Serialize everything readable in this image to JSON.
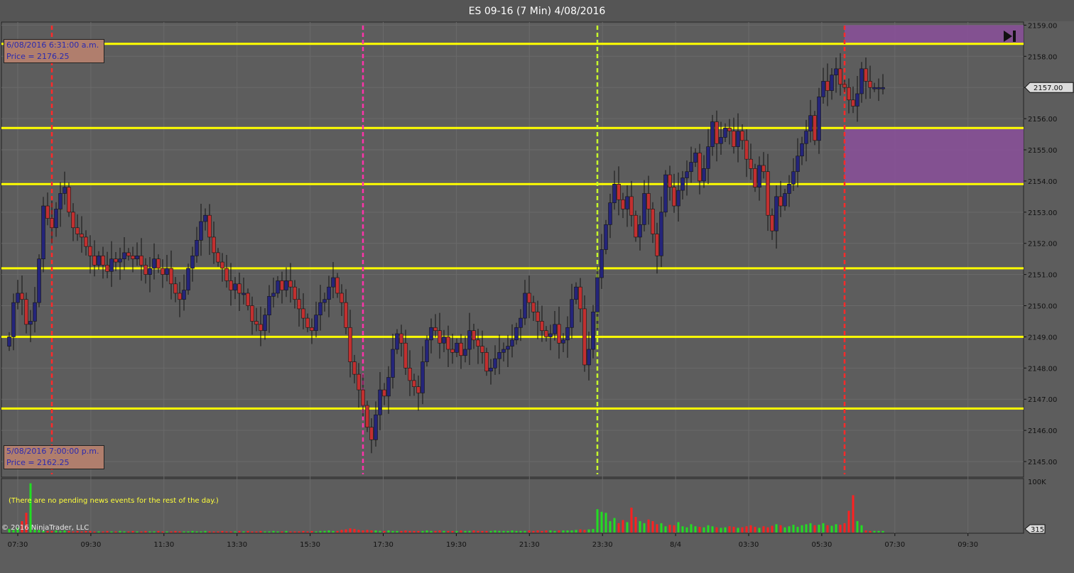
{
  "window": {
    "title": "ES 09-16 (7 Min)  4/08/2016"
  },
  "colors": {
    "background": "#5d5d5d",
    "grid": "#6a6a6a",
    "up_candle": "#24247a",
    "down_candle": "#c23030",
    "wick": "#141414",
    "level_line": "#ffff00",
    "session_line_red": "#ff2a2a",
    "session_line_magenta": "#ff33aa",
    "session_line_green": "#c8ff2a",
    "zone": "#8a4f9a",
    "volume_up": "#22dd22",
    "volume_down": "#ff2020"
  },
  "annotations": {
    "top_box": {
      "line1": "6/08/2016 6:31:00 a.m.",
      "line2": "Price = 2176.25"
    },
    "bottom_box": {
      "line1": "5/08/2016 7:00:00 p.m.",
      "line2": "Price = 2162.25"
    },
    "news": "(There are no pending news events for the rest of the day.)",
    "copyright": "© 2016 NinjaTrader, LLC",
    "skip_to_end_icon": "skip-to-end-icon"
  },
  "chart_data": {
    "type": "candlestick",
    "title": "ES 09-16 (7 Min)  4/08/2016",
    "price_axis": {
      "min": 2144.5,
      "max": 2159.1,
      "ticks": [
        2145,
        2146,
        2147,
        2148,
        2149,
        2150,
        2151,
        2152,
        2153,
        2154,
        2155,
        2156,
        2157,
        2158,
        2159
      ],
      "tick_labels": [
        "2145.00",
        "2146.00",
        "2147.00",
        "2148.00",
        "2149.00",
        "2150.00",
        "2151.00",
        "2152.00",
        "2153.00",
        "2154.00",
        "2155.00",
        "2156.00",
        "2157.00",
        "2158.00",
        "2159.00"
      ]
    },
    "last_price_label": "2157.00",
    "volume_axis": {
      "max_label": "100K",
      "last_label": "315"
    },
    "time_labels": [
      "07:30",
      "09:30",
      "11:30",
      "13:30",
      "15:30",
      "17:30",
      "19:30",
      "21:30",
      "23:30",
      "8/4",
      "03:30",
      "05:30",
      "07:30",
      "09:30"
    ],
    "bar_interval_minutes": 7,
    "level_lines": [
      2158.4,
      2155.7,
      2153.9,
      2151.2,
      2149.0,
      2146.7
    ],
    "session_markers": [
      {
        "bar": 10,
        "style": "red"
      },
      {
        "bar": 83,
        "style": "magenta"
      },
      {
        "bar": 138,
        "style": "green"
      },
      {
        "bar": 196,
        "style": "red"
      }
    ],
    "zones": [
      {
        "from_bar": 196,
        "price_low": 2158.4,
        "price_high": 2159.0
      },
      {
        "from_bar": 196,
        "price_low": 2153.9,
        "price_high": 2155.7
      }
    ],
    "close": [
      2149.0,
      2150.1,
      2150.4,
      2150.2,
      2149.4,
      2149.5,
      2150.1,
      2151.5,
      2153.2,
      2152.8,
      2152.5,
      2153.1,
      2153.6,
      2153.8,
      2153.0,
      2152.5,
      2152.3,
      2152.2,
      2151.9,
      2151.6,
      2151.3,
      2151.6,
      2151.3,
      2151.1,
      2151.5,
      2151.4,
      2151.5,
      2151.7,
      2151.6,
      2151.5,
      2151.6,
      2151.3,
      2151.0,
      2151.2,
      2151.5,
      2151.2,
      2151.0,
      2151.2,
      2150.7,
      2150.4,
      2150.2,
      2150.5,
      2151.2,
      2151.6,
      2152.1,
      2152.7,
      2152.9,
      2152.2,
      2151.7,
      2151.4,
      2151.2,
      2150.8,
      2150.5,
      2150.7,
      2150.4,
      2150.4,
      2150.0,
      2149.5,
      2149.4,
      2149.2,
      2149.7,
      2150.3,
      2150.4,
      2150.8,
      2150.5,
      2150.8,
      2150.6,
      2150.2,
      2149.9,
      2149.6,
      2149.3,
      2149.2,
      2149.7,
      2150.1,
      2150.2,
      2150.6,
      2150.9,
      2150.4,
      2150.1,
      2149.3,
      2148.2,
      2147.8,
      2147.3,
      2146.8,
      2146.1,
      2145.7,
      2146.5,
      2147.3,
      2147.1,
      2147.7,
      2148.6,
      2149.1,
      2148.8,
      2148.0,
      2147.6,
      2147.4,
      2147.2,
      2148.2,
      2148.9,
      2149.3,
      2149.2,
      2148.8,
      2149.0,
      2148.6,
      2148.5,
      2148.8,
      2148.4,
      2148.6,
      2149.2,
      2148.9,
      2148.7,
      2148.5,
      2147.9,
      2148.0,
      2148.3,
      2148.5,
      2148.6,
      2148.7,
      2148.9,
      2149.3,
      2149.6,
      2150.4,
      2150.1,
      2149.8,
      2149.5,
      2149.2,
      2149.0,
      2149.1,
      2149.4,
      2148.8,
      2148.9,
      2149.3,
      2150.2,
      2150.6,
      2149.9,
      2148.1,
      2148.6,
      2149.8,
      2150.9,
      2151.8,
      2152.6,
      2153.3,
      2153.9,
      2153.4,
      2153.1,
      2153.5,
      2152.9,
      2152.2,
      2152.6,
      2153.6,
      2153.1,
      2152.3,
      2151.6,
      2153.0,
      2154.2,
      2153.8,
      2153.2,
      2153.7,
      2154.1,
      2154.3,
      2154.6,
      2154.9,
      2154.0,
      2154.4,
      2155.1,
      2155.9,
      2155.2,
      2155.4,
      2155.7,
      2155.6,
      2155.1,
      2155.6,
      2155.3,
      2154.7,
      2154.4,
      2153.8,
      2154.5,
      2154.3,
      2152.9,
      2152.4,
      2153.5,
      2153.2,
      2153.6,
      2153.9,
      2154.3,
      2154.8,
      2155.2,
      2155.6,
      2156.1,
      2155.3,
      2156.7,
      2157.2,
      2156.9,
      2157.4,
      2157.6,
      2157.1,
      2157.0,
      2156.6,
      2156.4,
      2156.8,
      2157.6,
      2157.2,
      2157.0,
      2157.0,
      2157.0,
      2157.0
    ],
    "volume": [
      7,
      5,
      9,
      22,
      38,
      95,
      6,
      5,
      4,
      3,
      3,
      4,
      3,
      4,
      3,
      2,
      3,
      2,
      3,
      3,
      2,
      2,
      2,
      3,
      2,
      2,
      3,
      2,
      2,
      3,
      2,
      2,
      3,
      2,
      2,
      3,
      2,
      2,
      2,
      3,
      2,
      2,
      2,
      3,
      2,
      2,
      3,
      2,
      2,
      2,
      3,
      2,
      2,
      2,
      3,
      2,
      3,
      2,
      2,
      3,
      2,
      2,
      3,
      2,
      2,
      3,
      2,
      2,
      2,
      3,
      2,
      3,
      2,
      3,
      3,
      4,
      3,
      3,
      5,
      6,
      8,
      7,
      5,
      4,
      5,
      4,
      4,
      3,
      3,
      4,
      3,
      3,
      3,
      4,
      3,
      3,
      3,
      3,
      4,
      3,
      3,
      4,
      3,
      3,
      3,
      3,
      4,
      3,
      3,
      4,
      3,
      3,
      3,
      3,
      4,
      3,
      3,
      3,
      4,
      3,
      3,
      3,
      4,
      3,
      4,
      3,
      4,
      4,
      3,
      4,
      4,
      4,
      4,
      5,
      6,
      5,
      6,
      7,
      45,
      40,
      38,
      22,
      28,
      18,
      24,
      20,
      48,
      30,
      22,
      18,
      25,
      22,
      16,
      18,
      12,
      15,
      14,
      20,
      12,
      10,
      16,
      12,
      11,
      10,
      14,
      12,
      10,
      9,
      10,
      12,
      11,
      9,
      10,
      12,
      14,
      11,
      9,
      12,
      10,
      13,
      16,
      14,
      10,
      12,
      15,
      11,
      14,
      16,
      18,
      14,
      15,
      18,
      14,
      13,
      16,
      15,
      18,
      42,
      72,
      22,
      14,
      4,
      3,
      3,
      3,
      3
    ]
  }
}
